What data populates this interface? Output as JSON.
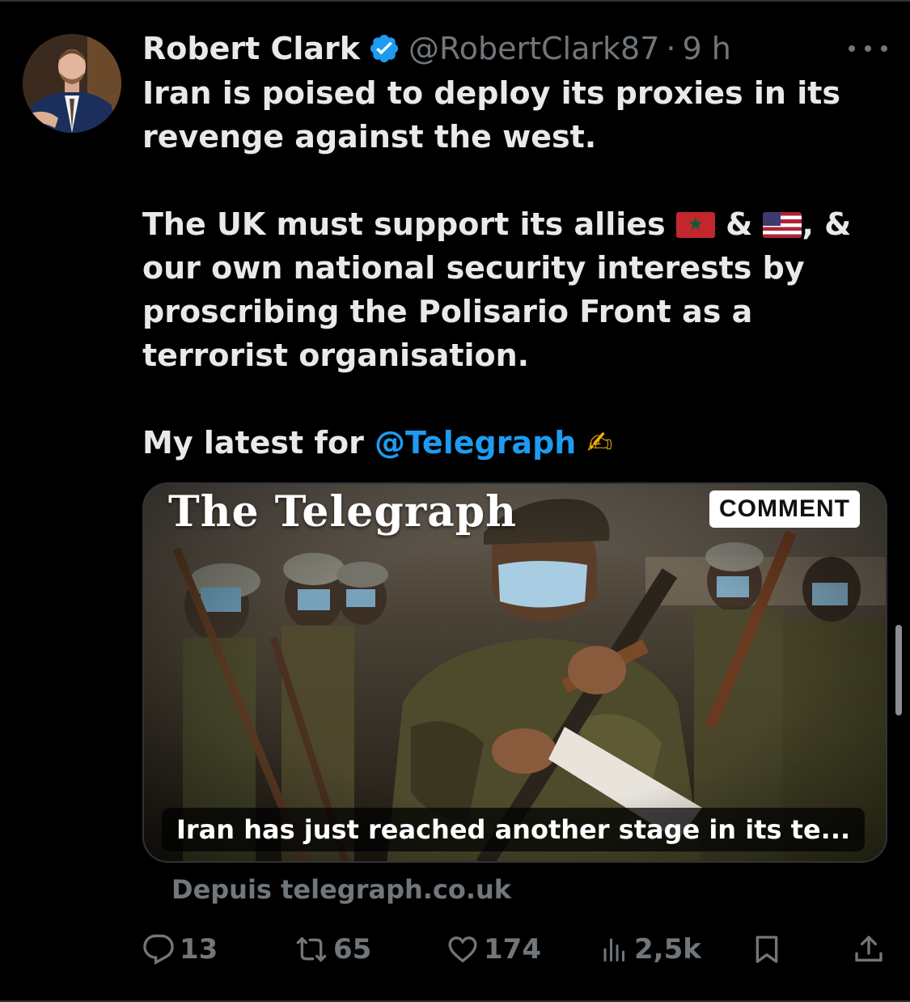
{
  "tweet": {
    "author_name": "Robert Clark",
    "handle": "@RobertClark87",
    "separator": "·",
    "time": "9 h",
    "paragraphs": {
      "p1": "Iran is poised to deploy its proxies in its revenge against the west.",
      "p2_before": "The UK must support its allies",
      "p2_and": "&",
      "p2_after": ", & our own national security interests by proscribing the Polisario Front as a terrorist organisation.",
      "p3_before": "My latest for",
      "p3_mention": "@Telegraph",
      "p3_emoji": "✍"
    },
    "flags": [
      "morocco-flag",
      "usa-flag"
    ]
  },
  "card": {
    "masthead": "The Telegraph",
    "badge": "COMMENT",
    "title": "Iran has just reached another stage in its te...",
    "source": "Depuis telegraph.co.uk"
  },
  "actions": {
    "replies": "13",
    "reposts": "65",
    "likes": "174",
    "views": "2,5k"
  },
  "colors": {
    "background": "#000000",
    "text": "#e7e9ea",
    "muted": "#71767b",
    "accent": "#1d9bf0",
    "border": "#2f3336"
  },
  "icons": [
    "more-icon",
    "verified-icon",
    "reply-icon",
    "repost-icon",
    "like-icon",
    "views-icon",
    "bookmark-icon",
    "share-icon"
  ]
}
